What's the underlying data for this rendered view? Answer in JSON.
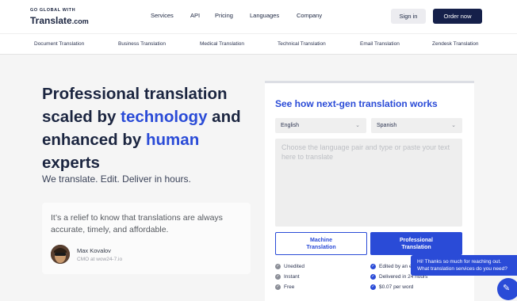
{
  "header": {
    "logo_tagline": "GO GLOBAL WITH",
    "logo_name": "Translate",
    "logo_suffix": ".com",
    "nav": [
      "Services",
      "API",
      "Pricing",
      "Languages",
      "Company"
    ],
    "signin_label": "Sign in",
    "order_label": "Order now"
  },
  "subnav": [
    "Document Translation",
    "Business Translation",
    "Medical Translation",
    "Technical Translation",
    "Email Translation",
    "Zendesk Translation"
  ],
  "hero": {
    "title_1": "Professional translation scaled by ",
    "title_hl_1": "technology",
    "title_2": " and enhanced by ",
    "title_hl_2": "human",
    "title_3": " experts",
    "subtitle": "We translate. Edit. Deliver in hours."
  },
  "testimonial": {
    "quote": "It’s a relief to know that translations are always accurate, timely, and affordable.",
    "name": "Max Kovalov",
    "role": "CMO at wow24-7.io"
  },
  "widget": {
    "title": "See how next-gen translation works",
    "source_lang": "English",
    "target_lang": "Spanish",
    "placeholder": "Choose the language pair and type or paste your text here to translate",
    "machine_label_1": "Machine",
    "machine_label_2": "Translation",
    "pro_label_1": "Professional",
    "pro_label_2": "Translation",
    "machine_features": [
      "Unedited",
      "Instant",
      "Free"
    ],
    "pro_features": [
      "Edited by an e",
      "Delivered in 24 hours",
      "$0.07 per word"
    ]
  },
  "chat": {
    "line_1": "Hi! Thanks so much for reaching out.",
    "line_2": "What translation services do you need?"
  },
  "colors": {
    "brand_navy": "#15204a",
    "accent_blue": "#2a4bd7",
    "background": "#f5f5f5"
  },
  "icons": [
    "chevron-down-icon",
    "check-circle-icon",
    "chat-icon"
  ]
}
